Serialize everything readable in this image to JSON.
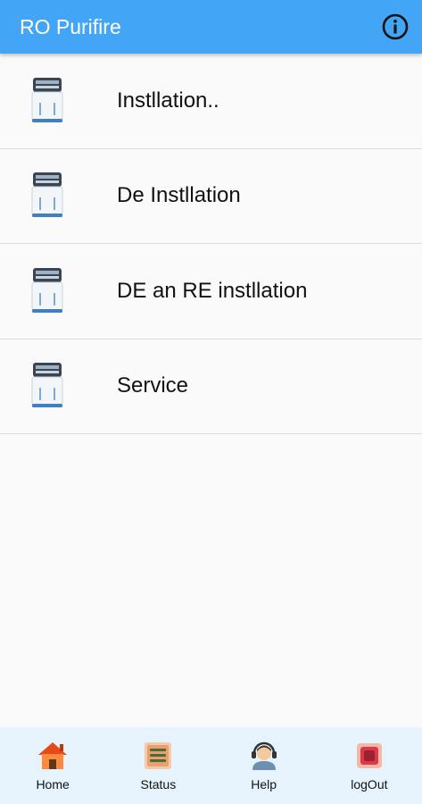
{
  "app_bar": {
    "title": "RO Purifire",
    "info_icon": "info-icon"
  },
  "menu": {
    "items": [
      {
        "label": "Instllation..",
        "icon": "water-purifier-icon"
      },
      {
        "label": "De Instllation",
        "icon": "water-purifier-icon"
      },
      {
        "label": "DE an RE instllation",
        "icon": "water-purifier-icon"
      },
      {
        "label": "Service",
        "icon": "water-purifier-icon"
      }
    ]
  },
  "bottom_nav": {
    "items": [
      {
        "label": "Home",
        "icon": "home-icon"
      },
      {
        "label": "Status",
        "icon": "status-icon"
      },
      {
        "label": "Help",
        "icon": "help-agent-icon"
      },
      {
        "label": "logOut",
        "icon": "logout-icon"
      }
    ]
  },
  "colors": {
    "app_bar": "#42a5f5",
    "bottom_nav": "#e6f3fd",
    "background": "#fafafa"
  }
}
